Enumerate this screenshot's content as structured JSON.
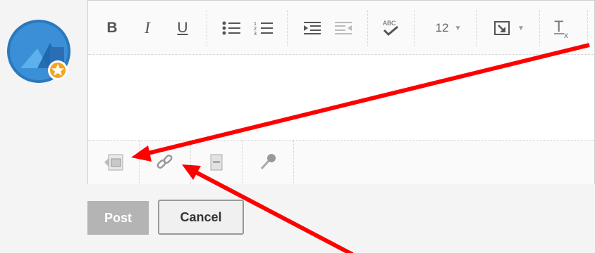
{
  "user": {
    "avatar_icon": "avatar-icon",
    "badge_icon": "star-badge-icon"
  },
  "toolbar": {
    "bold_label": "B",
    "italic_label": "I",
    "underline_label": "U",
    "font_size": "12"
  },
  "bottom_tools": [
    {
      "name": "insert-image-icon"
    },
    {
      "name": "insert-link-icon"
    },
    {
      "name": "insert-file-icon"
    },
    {
      "name": "microphone-icon"
    }
  ],
  "actions": {
    "post_label": "Post",
    "cancel_label": "Cancel"
  },
  "colors": {
    "annotation_arrow": "#ff0000",
    "post_bg": "#b4b4b4"
  }
}
